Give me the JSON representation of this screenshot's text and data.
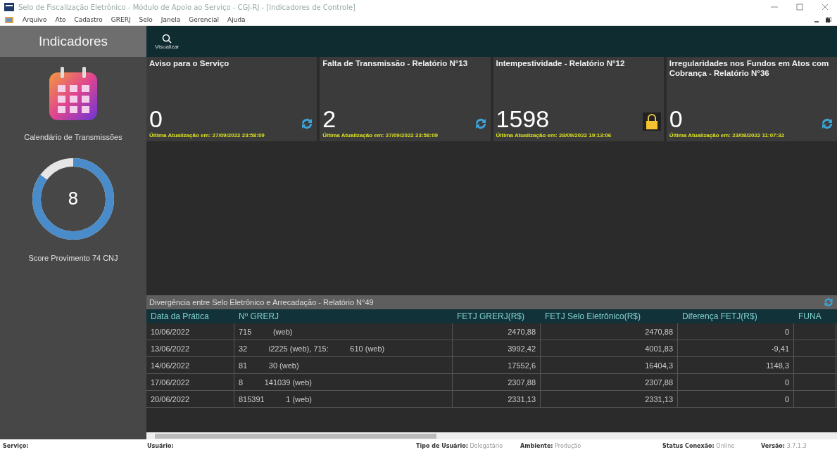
{
  "window": {
    "title": "Selo de Fiscalização Eletrônico - Módulo de Apoio ao Serviço - CGJ-RJ - [Indicadores de Controle]"
  },
  "menu": [
    "Arquivo",
    "Ato",
    "Cadastro",
    "GRERJ",
    "Selo",
    "Janela",
    "Gerencial",
    "Ajuda"
  ],
  "sidebar": {
    "title": "Indicadores",
    "calendar_label": "Calendário de Transmissões",
    "score": {
      "value": "8",
      "label": "Score Provimento 74 CNJ"
    }
  },
  "toolbar": {
    "button": "Visualizar"
  },
  "cards": [
    {
      "title": "Aviso para o Serviço",
      "value": "0",
      "updated": "Última Atualização em: 27/09/2022 23:58:09",
      "kind": "refresh"
    },
    {
      "title": "Falta de Transmissão - Relatório N°13",
      "value": "2",
      "updated": "Última Atualização em: 27/09/2022 23:58:09",
      "kind": "refresh"
    },
    {
      "title": "Intempestividade - Relatório N°12",
      "value": "1598",
      "updated": "Última Atualização em: 28/09/2022 19:13:06",
      "kind": "lock"
    },
    {
      "title": "Irregularidades nos Fundos em Atos com Cobrança - Relatório N°36",
      "value": "0",
      "updated": "Última Atualização em: 23/08/2022 11:07:32",
      "kind": "refresh"
    }
  ],
  "table": {
    "title": "Divergência entre Selo Eletrônico e Arrecadação - Relatório N°49",
    "columns": [
      "Data da Prática",
      "Nº GRERJ",
      "FETJ GRERJ(R$)",
      "FETJ Selo Eletrônico(R$)",
      "Diferença FETJ(R$)",
      "FUNA"
    ],
    "rows": [
      [
        "10/06/2022",
        "715          (web)",
        "2470,88",
        "2470,88",
        "0"
      ],
      [
        "13/06/2022",
        "32          i2225 (web), 715:          610 (web)",
        "3992,42",
        "4001,83",
        "-9,41"
      ],
      [
        "14/06/2022",
        "81          30 (web)",
        "17552,6",
        "16404,3",
        "1148,3"
      ],
      [
        "17/06/2022",
        "8          141039 (web)",
        "2307,88",
        "2307,88",
        "0"
      ],
      [
        "20/06/2022",
        "815391          1 (web)",
        "2331,13",
        "2331,13",
        "0"
      ]
    ]
  },
  "status_bar": [
    {
      "label": "Serviço:"
    },
    {
      "label": "Usuário:"
    },
    {
      "label": "Tipo de Usuário:",
      "value": "Delegatário"
    },
    {
      "label": "Ambiente:",
      "value": "Produção"
    },
    {
      "label": "Status Conexão:",
      "value": "Online"
    },
    {
      "label": "Versão:",
      "value": "3.7.1.3"
    }
  ]
}
